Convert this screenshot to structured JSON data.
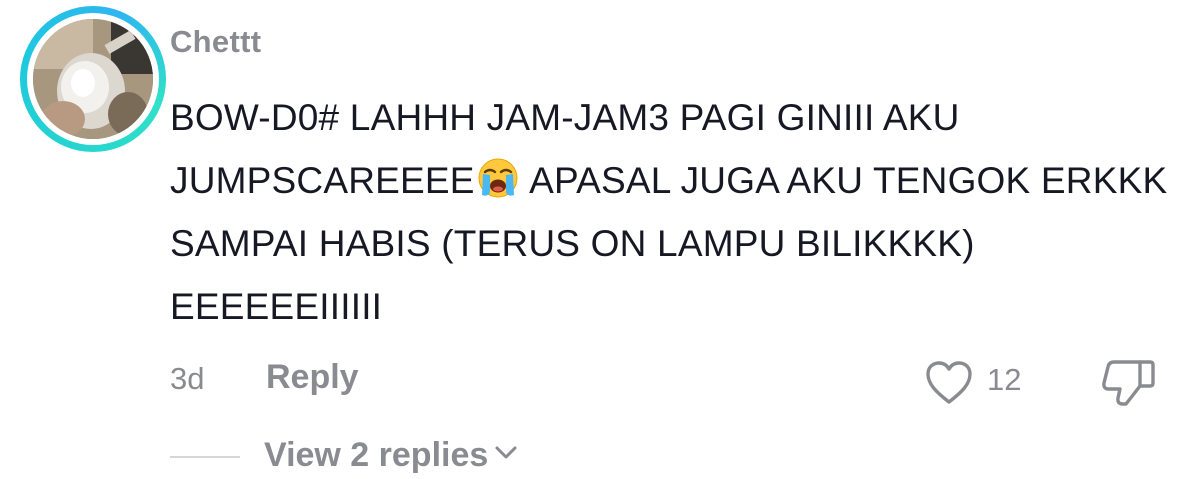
{
  "comment": {
    "username": "Chettt",
    "text_before_emoji": "BOW-D0# LAHHH JAM-JAM3 PAGI GINIII AKU JUMPSCAREEEE",
    "emoji": "loudly-crying-face-icon",
    "text_after_emoji": " APASAL JUGA AKU TENGOK ERKKK SAMPAI HABIS (TERUS ON LAMPU BILIKKKK) EEEEEEIIIIII",
    "timestamp": "3d",
    "reply_label": "Reply",
    "like_count": "12",
    "view_replies_label": "View 2 replies"
  },
  "icons": {
    "like": "heart-icon",
    "dislike": "thumbs-down-icon",
    "expand": "chevron-down-icon"
  },
  "colors": {
    "text_primary": "#161823",
    "text_secondary": "#8a8b91",
    "avatar_ring": "#25d4d0"
  }
}
